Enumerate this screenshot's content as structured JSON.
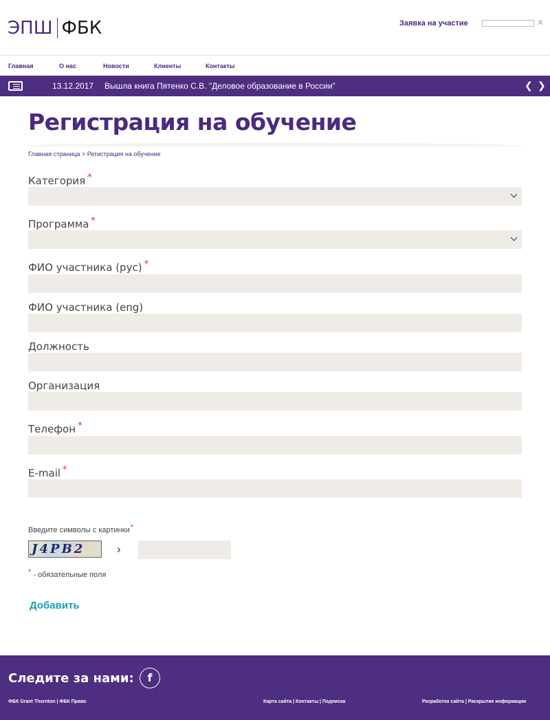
{
  "header": {
    "logo_left": "ЭПШ",
    "logo_right": "ФБК",
    "apply_link": "Заявка на участие",
    "search_placeholder": "",
    "search_clear": "✕"
  },
  "nav": {
    "items": [
      "Главная",
      "О нас",
      "Новости",
      "Клиенты",
      "Контакты"
    ]
  },
  "ticker": {
    "date": "13.12.2017",
    "text": "Вышла книга Пятенко С.В. \"Деловое образование в России\"",
    "prev": "❮",
    "next": "❯"
  },
  "page": {
    "title": "Регистрация на обучение",
    "breadcrumb": "Главная страница > Регистрация на обучение"
  },
  "form": {
    "required_mark": "*",
    "fields": [
      {
        "label": "Категория",
        "required": true,
        "type": "select"
      },
      {
        "label": "Программа",
        "required": true,
        "type": "select"
      },
      {
        "label": "ФИО участника (рус)",
        "required": true,
        "type": "text"
      },
      {
        "label": "ФИО участника (eng)",
        "required": false,
        "type": "text"
      },
      {
        "label": "Должность",
        "required": false,
        "type": "text"
      },
      {
        "label": "Организация",
        "required": false,
        "type": "text"
      },
      {
        "label": "Телефон",
        "required": true,
        "type": "text"
      },
      {
        "label": "E-mail",
        "required": true,
        "type": "text"
      }
    ],
    "captcha_label": "Введите символы с картинки",
    "captcha_text": "J4PB2",
    "captcha_arrow": "›",
    "required_note": "- обязательные поля",
    "submit_label": "Добавить"
  },
  "footer": {
    "follow_text": "Следите за нами:",
    "facebook_glyph": "f",
    "left_links": "ФБК Grant Thornton | ФБК Право",
    "middle_links": "Карта сайта | Контакты | Подписка",
    "right_links": "Разработка сайта | Раскрытие информации"
  }
}
